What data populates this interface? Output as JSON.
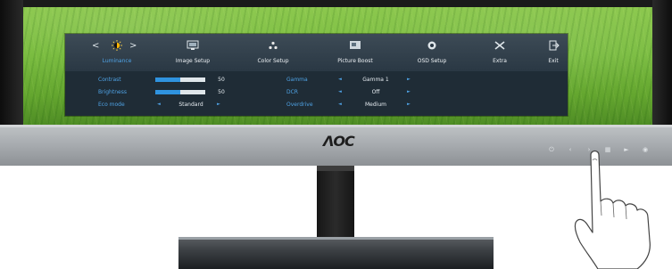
{
  "brand": {
    "logo_text": "ΛOC"
  },
  "osd": {
    "tabs": [
      {
        "label": "Luminance",
        "icon": "sun-icon",
        "selected": true
      },
      {
        "label": "Image Setup",
        "icon": "image-setup-icon",
        "selected": false
      },
      {
        "label": "Color Setup",
        "icon": "color-setup-icon",
        "selected": false
      },
      {
        "label": "Picture Boost",
        "icon": "picture-boost-icon",
        "selected": false
      },
      {
        "label": "OSD Setup",
        "icon": "osd-setup-icon",
        "selected": false
      },
      {
        "label": "Extra",
        "icon": "extra-icon",
        "selected": false
      },
      {
        "label": "Exit",
        "icon": "exit-icon",
        "selected": false
      }
    ],
    "nav_left": "<",
    "nav_right": ">",
    "settings": {
      "contrast": {
        "label": "Contrast",
        "value": "50",
        "level": 0.5
      },
      "brightness": {
        "label": "Brightness",
        "value": "50",
        "level": 0.5
      },
      "eco_mode": {
        "label": "Eco mode",
        "value": "Standard"
      },
      "gamma": {
        "label": "Gamma",
        "value": "Gamma 1"
      },
      "dcr": {
        "label": "DCR",
        "value": "Off"
      },
      "overdrive": {
        "label": "Overdrive",
        "value": "Medium"
      }
    }
  },
  "buttons": [
    {
      "name": "power-button",
      "glyph": "⏻"
    },
    {
      "name": "down-button",
      "glyph": "‹"
    },
    {
      "name": "up-button",
      "glyph": "›"
    },
    {
      "name": "menu-button",
      "glyph": "▦"
    },
    {
      "name": "source-button",
      "glyph": "►"
    },
    {
      "name": "auto-button",
      "glyph": "◉"
    }
  ],
  "colors": {
    "osd_background": "#1f2c36",
    "accent": "#4fa3e6",
    "screen_green": "#7bbd41"
  }
}
